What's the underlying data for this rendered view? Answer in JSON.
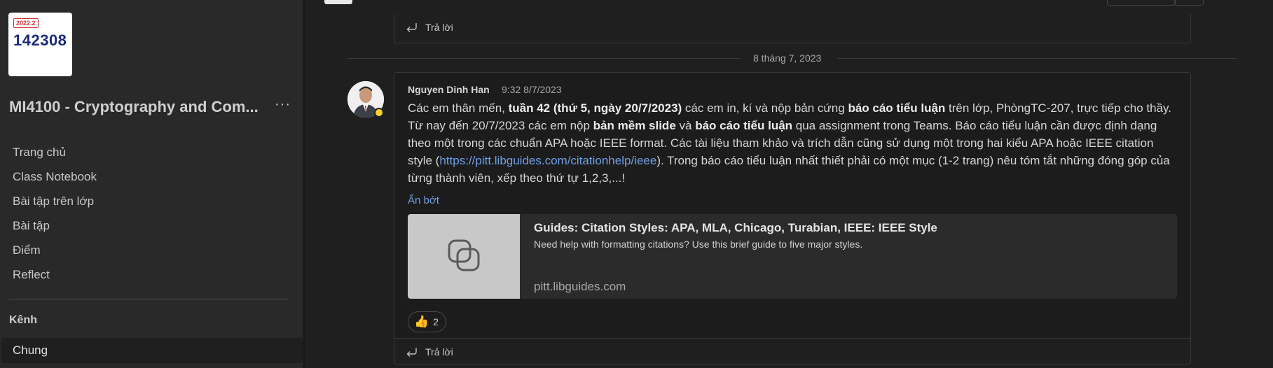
{
  "team": {
    "tile_badge": "2022.2",
    "tile_code": "142308",
    "name": "MI4100 - Cryptography and Com...",
    "more_label": "···"
  },
  "nav": {
    "items": [
      {
        "label": "Trang chủ"
      },
      {
        "label": "Class Notebook"
      },
      {
        "label": "Bài tập trên lớp"
      },
      {
        "label": "Bài tập"
      },
      {
        "label": "Điểm"
      },
      {
        "label": "Reflect"
      }
    ],
    "channels_header": "Kênh",
    "active_channel": "Chung"
  },
  "thread": {
    "reply_label": "Trả lời",
    "date_separator": "8 tháng 7, 2023"
  },
  "post": {
    "author": "Nguyen Dinh Han",
    "time": "9:32 8/7/2023",
    "body_parts": {
      "p1": "Các em thân mến, ",
      "b1": "tuần 42 (thứ 5, ngày 20/7/2023)",
      "p2": " các em in, kí và nộp bản cứng ",
      "b2": "báo cáo tiểu luận",
      "p3": " trên lớp, PhòngTC-207, trực tiếp cho thầy. Từ nay đến 20/7/2023 các em nộp ",
      "b3": "bản mềm slide",
      "p4": " và ",
      "b4": "báo cáo tiểu luận",
      "p5": " qua assignment trong Teams. Báo cáo tiểu luận cần được định dạng theo một trong các chuẩn APA hoặc IEEE format. Các tài liệu tham khảo và trích dẫn cũng sử dụng một trong hai kiểu APA hoặc IEEE citation style (",
      "link": "https://pitt.libguides.com/citationhelp/ieee",
      "p6": "). Trong báo cáo tiểu luận nhất thiết phải có một mục (1-2 trang) nêu tóm tắt những đóng góp của từng thành viên, xếp theo thứ tự 1,2,3,...!"
    },
    "collapse_label": "Ẩn bớt",
    "link_preview": {
      "title": "Guides: Citation Styles: APA, MLA, Chicago, Turabian, IEEE: IEEE Style",
      "description": "Need help with formatting citations? Use this brief guide to five major styles.",
      "domain": "pitt.libguides.com",
      "thumb_icon": "copy-link-icon"
    },
    "reaction": {
      "emoji": "👍",
      "count": "2",
      "icon": "thumbs-up-icon"
    }
  },
  "colors": {
    "background": "#1f1f1f",
    "sidebar": "#292929",
    "link": "#6f9fe8",
    "status_available": "#f8d22a"
  }
}
